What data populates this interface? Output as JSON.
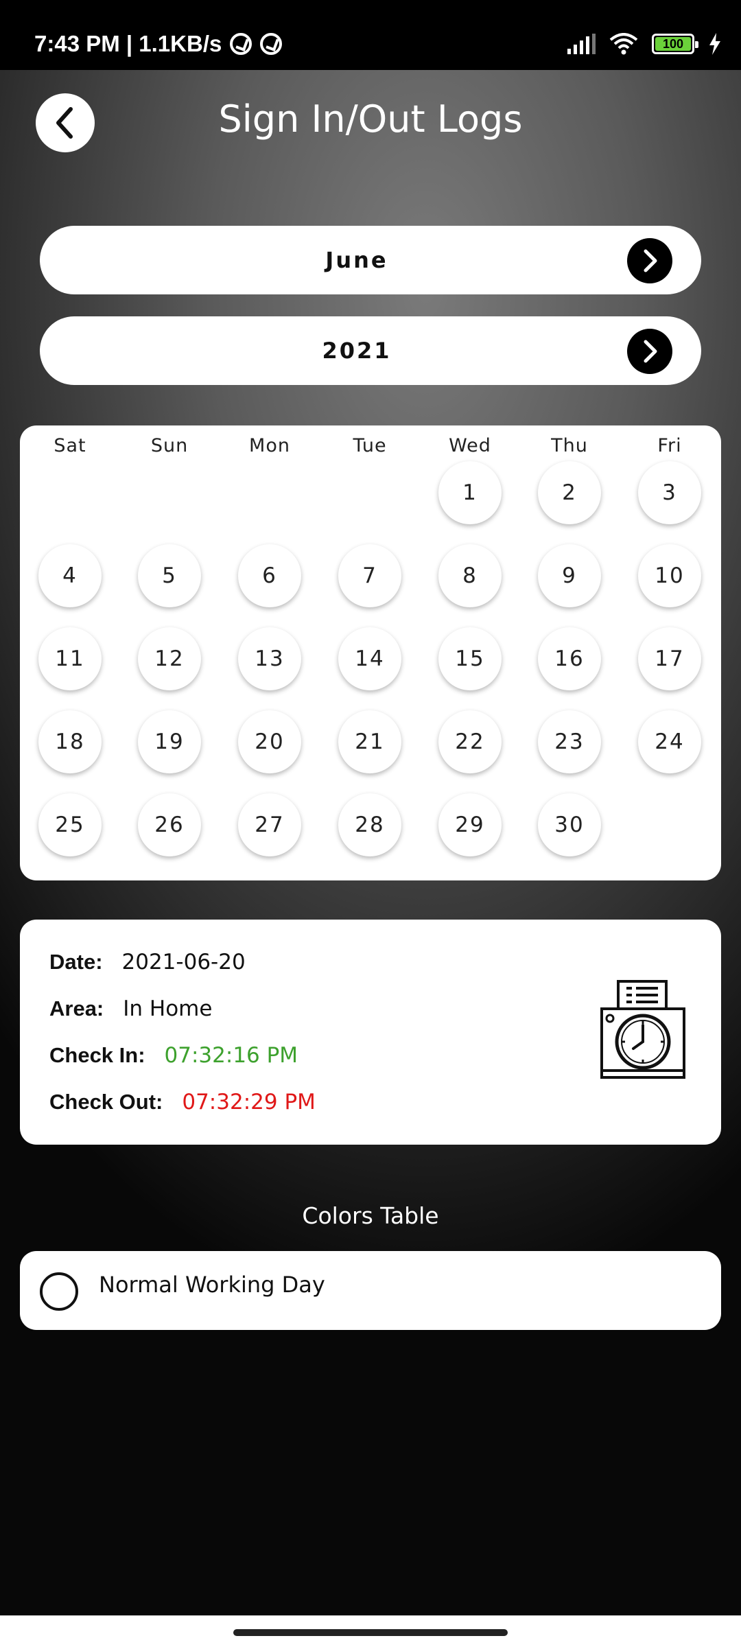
{
  "status_bar": {
    "time_speed": "7:43 PM | 1.1KB/s",
    "battery": "100"
  },
  "header": {
    "title": "Sign In/Out Logs"
  },
  "month_picker": {
    "value": "June"
  },
  "year_picker": {
    "value": "2021"
  },
  "calendar": {
    "weekdays": [
      "Sat",
      "Sun",
      "Mon",
      "Tue",
      "Wed",
      "Thu",
      "Fri"
    ],
    "days": [
      "1",
      "2",
      "3",
      "4",
      "5",
      "6",
      "7",
      "8",
      "9",
      "10",
      "11",
      "12",
      "13",
      "14",
      "15",
      "16",
      "17",
      "18",
      "19",
      "20",
      "21",
      "22",
      "23",
      "24",
      "25",
      "26",
      "27",
      "28",
      "29",
      "30"
    ]
  },
  "log_details": {
    "date_label": "Date:",
    "date_value": "2021-06-20",
    "area_label": "Area:",
    "area_value": "In Home",
    "check_in_label": "Check In:",
    "check_in_value": "07:32:16 PM",
    "check_out_label": "Check Out:",
    "check_out_value": "07:32:29 PM",
    "icon": "time-clock-icon"
  },
  "colors_table": {
    "title": "Colors Table",
    "items": [
      {
        "label": "Normal Working Day"
      }
    ]
  },
  "colors": {
    "check_in": "#3da12d",
    "check_out": "#e01818"
  }
}
